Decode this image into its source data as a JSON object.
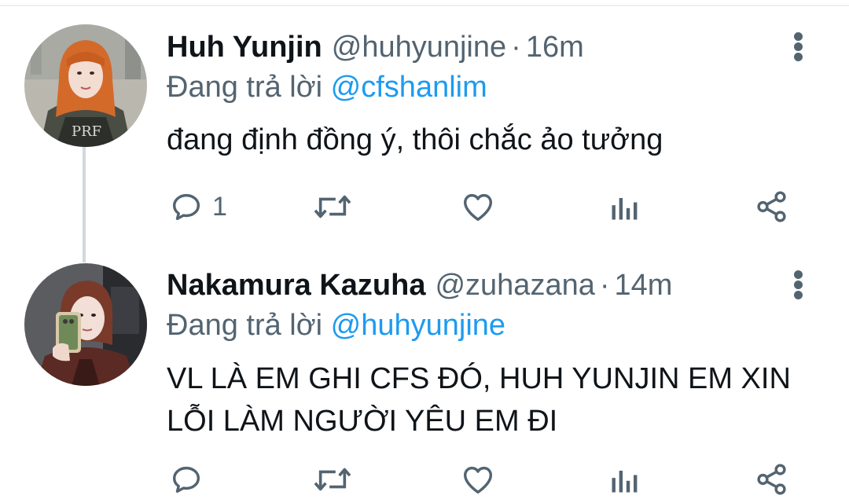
{
  "tweets": [
    {
      "display_name": "Huh Yunjin",
      "handle": "@huhyunjine",
      "separator": "·",
      "time": "16m",
      "replying_prefix": "Đang trả lời",
      "replying_to": "@cfshanlim",
      "text": "đang định đồng ý, thôi chắc ảo tưởng",
      "reply_count": "1",
      "retweet_count": "",
      "like_count": ""
    },
    {
      "display_name": "Nakamura Kazuha",
      "handle": "@zuhazana",
      "separator": "·",
      "time": "14m",
      "replying_prefix": "Đang trả lời",
      "replying_to": "@huhyunjine",
      "text": "VL LÀ EM GHI CFS ĐÓ, HUH YUNJIN EM XIN LỖI LÀM NGƯỜI YÊU EM ĐI",
      "reply_count": "",
      "retweet_count": "",
      "like_count": ""
    }
  ],
  "colors": {
    "primary_text": "#0f1419",
    "secondary_text": "#536471",
    "link": "#1d9bf0",
    "thread_line": "#cfd9de"
  },
  "icons": [
    "reply-icon",
    "retweet-icon",
    "like-icon",
    "analytics-icon",
    "share-icon",
    "more-icon"
  ]
}
